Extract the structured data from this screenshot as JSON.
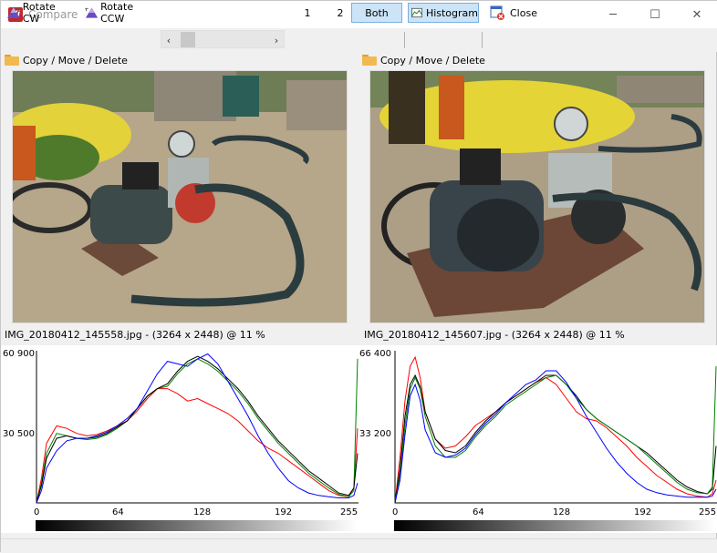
{
  "window": {
    "title": "Compare",
    "app_icon_text": "Vi",
    "minimize": "─",
    "maximize": "☐",
    "close": "✕"
  },
  "toolbar": {
    "rotate_cw": "Rotate CW",
    "rotate_ccw": "Rotate CCW",
    "scroll_left": "‹",
    "scroll_right": "›",
    "view_1": "1",
    "view_2": "2",
    "view_both": "Both",
    "histogram": "Histogram",
    "close": "Close",
    "active_view": "Both",
    "histogram_active": true
  },
  "panels": [
    {
      "menu": "Copy / Move / Delete",
      "caption": "IMG_20180412_145558.jpg -  (3264 x 2448) @ 11  %",
      "hist": {
        "ymax": "60 900",
        "ymid": "30 500",
        "xticks": [
          "0",
          "64",
          "128",
          "192",
          "255"
        ]
      }
    },
    {
      "menu": "Copy / Move / Delete",
      "caption": "IMG_20180412_145607.jpg -  (3264 x 2448) @ 11  %",
      "hist": {
        "ymax": "66 400",
        "ymid": "33 200",
        "xticks": [
          "0",
          "64",
          "128",
          "192",
          "255"
        ]
      }
    }
  ],
  "colors": {
    "accent": "#cce4f7",
    "accent_border": "#7ab0df",
    "red": "#ff0000",
    "green": "#008000",
    "blue": "#0000ff",
    "black": "#000000"
  },
  "chart_data": [
    {
      "type": "line",
      "title": "",
      "xlabel": "",
      "ylabel": "",
      "xlim": [
        0,
        255
      ],
      "ylim": [
        0,
        60900
      ],
      "x": [
        0,
        4,
        8,
        16,
        24,
        32,
        40,
        48,
        56,
        64,
        72,
        80,
        88,
        96,
        104,
        112,
        120,
        128,
        136,
        144,
        152,
        160,
        168,
        176,
        184,
        192,
        200,
        208,
        216,
        224,
        232,
        240,
        248,
        252,
        255
      ],
      "series": [
        {
          "name": "",
          "color": "#ff0000",
          "values": [
            0,
            10000,
            24000,
            31000,
            30000,
            28000,
            27000,
            27500,
            29000,
            31000,
            33000,
            37000,
            42000,
            46000,
            46000,
            44000,
            41000,
            42000,
            40000,
            38000,
            36000,
            33000,
            29000,
            25000,
            22000,
            20000,
            17000,
            14000,
            11000,
            8000,
            5000,
            3000,
            2500,
            6000,
            30000
          ]
        },
        {
          "name": "",
          "color": "#008000",
          "values": [
            0,
            8000,
            20000,
            28000,
            27000,
            26000,
            25500,
            26000,
            27500,
            30000,
            33000,
            38000,
            43000,
            46000,
            47000,
            52000,
            56000,
            58000,
            56000,
            53000,
            49000,
            45000,
            40000,
            34000,
            29000,
            24000,
            20000,
            16000,
            12000,
            9000,
            6000,
            3500,
            2500,
            5000,
            58000
          ]
        },
        {
          "name": "",
          "color": "#000000",
          "values": [
            0,
            7000,
            18000,
            26000,
            27000,
            26000,
            26000,
            26500,
            28000,
            30500,
            33000,
            38000,
            43000,
            46000,
            48000,
            53000,
            57000,
            59000,
            57000,
            54000,
            50000,
            46000,
            41000,
            35000,
            30000,
            25000,
            21000,
            17000,
            13000,
            10000,
            7000,
            4000,
            3000,
            6000,
            20000
          ]
        },
        {
          "name": "",
          "color": "#0000ff",
          "values": [
            0,
            5000,
            14000,
            21000,
            25000,
            26000,
            26000,
            27000,
            28500,
            31000,
            34000,
            38000,
            45000,
            52000,
            57000,
            56000,
            55000,
            58000,
            60000,
            56000,
            49000,
            42000,
            35000,
            27000,
            20000,
            14000,
            9000,
            6000,
            4000,
            3000,
            2500,
            2000,
            2000,
            3000,
            8000
          ]
        }
      ]
    },
    {
      "type": "line",
      "title": "",
      "xlabel": "",
      "ylabel": "",
      "xlim": [
        0,
        255
      ],
      "ylim": [
        0,
        66400
      ],
      "x": [
        0,
        4,
        8,
        12,
        16,
        20,
        24,
        32,
        40,
        48,
        56,
        64,
        72,
        80,
        88,
        96,
        104,
        112,
        120,
        128,
        136,
        144,
        152,
        160,
        168,
        176,
        184,
        192,
        200,
        208,
        216,
        224,
        232,
        240,
        248,
        252,
        255
      ],
      "series": [
        {
          "name": "",
          "color": "#ff0000",
          "values": [
            0,
            20000,
            45000,
            60000,
            64000,
            55000,
            40000,
            28000,
            24000,
            25000,
            29000,
            34000,
            37000,
            40000,
            44000,
            47000,
            50000,
            53000,
            55000,
            52000,
            46000,
            40000,
            37000,
            36000,
            33000,
            29000,
            25000,
            20000,
            16000,
            12000,
            9000,
            6000,
            4000,
            3000,
            2500,
            4000,
            10000
          ]
        },
        {
          "name": "",
          "color": "#000000",
          "values": [
            0,
            15000,
            38000,
            52000,
            56000,
            51000,
            40000,
            28000,
            23000,
            22000,
            25000,
            31000,
            36000,
            40000,
            44000,
            47000,
            50000,
            53000,
            56000,
            56000,
            52000,
            47000,
            41000,
            37000,
            34000,
            31000,
            28000,
            25000,
            22000,
            18000,
            14000,
            10000,
            7000,
            5000,
            4000,
            6000,
            25000
          ]
        },
        {
          "name": "",
          "color": "#008000",
          "values": [
            0,
            12000,
            34000,
            50000,
            55000,
            50000,
            38000,
            25000,
            20000,
            20000,
            23000,
            29000,
            34000,
            38000,
            43000,
            46000,
            49000,
            52000,
            55000,
            56000,
            52000,
            46000,
            41000,
            37000,
            34000,
            31000,
            28000,
            25000,
            21000,
            17000,
            13000,
            9000,
            6000,
            4500,
            4000,
            7000,
            60000
          ]
        },
        {
          "name": "",
          "color": "#0000ff",
          "values": [
            0,
            10000,
            30000,
            47000,
            52000,
            45000,
            32000,
            22000,
            20000,
            21000,
            24000,
            30000,
            35000,
            39000,
            44000,
            48000,
            52000,
            54000,
            58000,
            58000,
            53000,
            46000,
            38000,
            31000,
            24000,
            18000,
            13000,
            9000,
            6000,
            4500,
            3500,
            3000,
            2500,
            2500,
            2500,
            3000,
            6000
          ]
        }
      ]
    }
  ]
}
